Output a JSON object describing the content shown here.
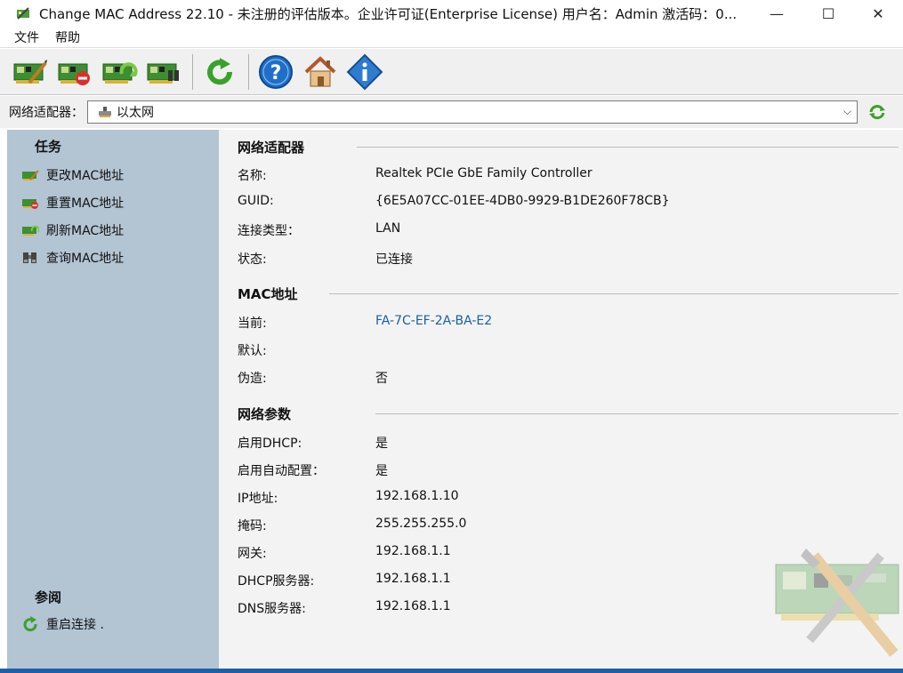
{
  "window": {
    "title": "Change MAC Address 22.10 - 未注册的评估版本。企业许可证(Enterprise License) 用户名：Admin 激活码：0...",
    "minimize": "—",
    "maximize": "☐",
    "close": "✕"
  },
  "menu": {
    "file": "文件",
    "help": "帮助"
  },
  "adapter": {
    "label": "网络适配器：",
    "selected": "以太网",
    "arrow": "⌵"
  },
  "sidebar": {
    "tasks_heading": "任务",
    "tasks": [
      "更改MAC地址",
      "重置MAC地址",
      "刷新MAC地址",
      "查询MAC地址"
    ],
    "see_also_heading": "参阅",
    "see_also": [
      "重启连接 ."
    ]
  },
  "sections": {
    "adapter": {
      "title": "网络适配器",
      "rows": [
        {
          "label": "名称:",
          "value": "Realtek PCIe GbE Family Controller"
        },
        {
          "label": "GUID:",
          "value": "{6E5A07CC-01EE-4DB0-9929-B1DE260F78CB}"
        },
        {
          "label": "连接类型：",
          "value": "LAN"
        },
        {
          "label": "状态:",
          "value": "已连接"
        }
      ]
    },
    "mac": {
      "title": "MAC地址",
      "rows": [
        {
          "label": "当前:",
          "value": "FA-7C-EF-2A-BA-E2"
        },
        {
          "label": "默认:",
          "value": ""
        },
        {
          "label": "伪造:",
          "value": "否"
        }
      ]
    },
    "network": {
      "title": "网络参数",
      "rows": [
        {
          "label": "启用DHCP:",
          "value": "是"
        },
        {
          "label": "启用自动配置：",
          "value": "是"
        },
        {
          "label": "IP地址:",
          "value": "192.168.1.10"
        },
        {
          "label": "掩码:",
          "value": "255.255.255.0"
        },
        {
          "label": "网关:",
          "value": "192.168.1.1"
        },
        {
          "label": "DHCP服务器:",
          "value": "192.168.1.1"
        },
        {
          "label": "DNS服务器:",
          "value": "192.168.1.1"
        }
      ]
    }
  },
  "colors": {
    "sidebar_bg": "#b3c4d3",
    "content_bg": "#f3f3f3",
    "link": "#1b5f9e",
    "accent_green": "#3aa12b",
    "help_blue": "#1f6fc7"
  }
}
